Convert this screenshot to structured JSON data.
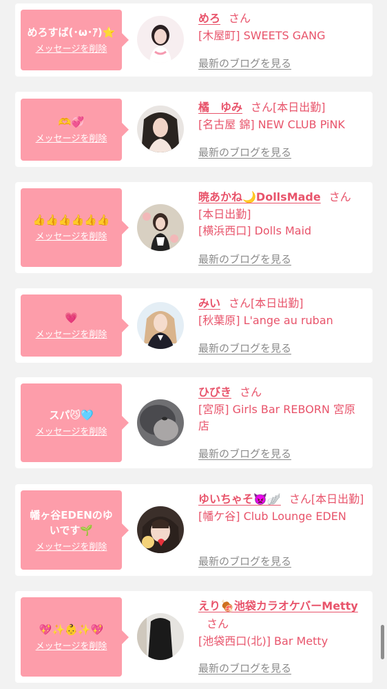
{
  "delete_label": "メッセージを削除",
  "blog_label": "最新のブログを見る",
  "honorific": "さん",
  "cards": [
    {
      "message": "めろすば(･ω･ｱ)⭐",
      "name": "めろ",
      "status": "",
      "shop": "[木屋町] SWEETS GANG"
    },
    {
      "message": "🫶💞",
      "name": "橘　ゆみ",
      "status": "[本日出勤]",
      "shop": "[名古屋 錦] NEW CLUB PiNK"
    },
    {
      "message": "👍👍👍👍👍👍",
      "name": "暁あかね🌙DollsMade",
      "status": "[本日出勤]",
      "shop": "[横浜西口] Dolls Maid"
    },
    {
      "message": "💗",
      "name": "みい",
      "status": "[本日出勤]",
      "shop": "[秋葉原] L'ange au ruban"
    },
    {
      "message": "スパ😼🩵",
      "name": "ひびき",
      "status": "",
      "shop": "[宮原] Girls Bar REBORN 宮原店"
    },
    {
      "message": "幡ヶ谷EDENのゆいです🌱",
      "name": "ゆいちゃそ👿🪽",
      "status": "[本日出勤]",
      "shop": "[幡ケ谷] Club Lounge EDEN"
    },
    {
      "message": "💖✨👶✨💖",
      "name": "えり🍖池袋カラオケバーMetty",
      "status": "",
      "shop": "[池袋西口(北)] Bar Metty"
    }
  ]
}
